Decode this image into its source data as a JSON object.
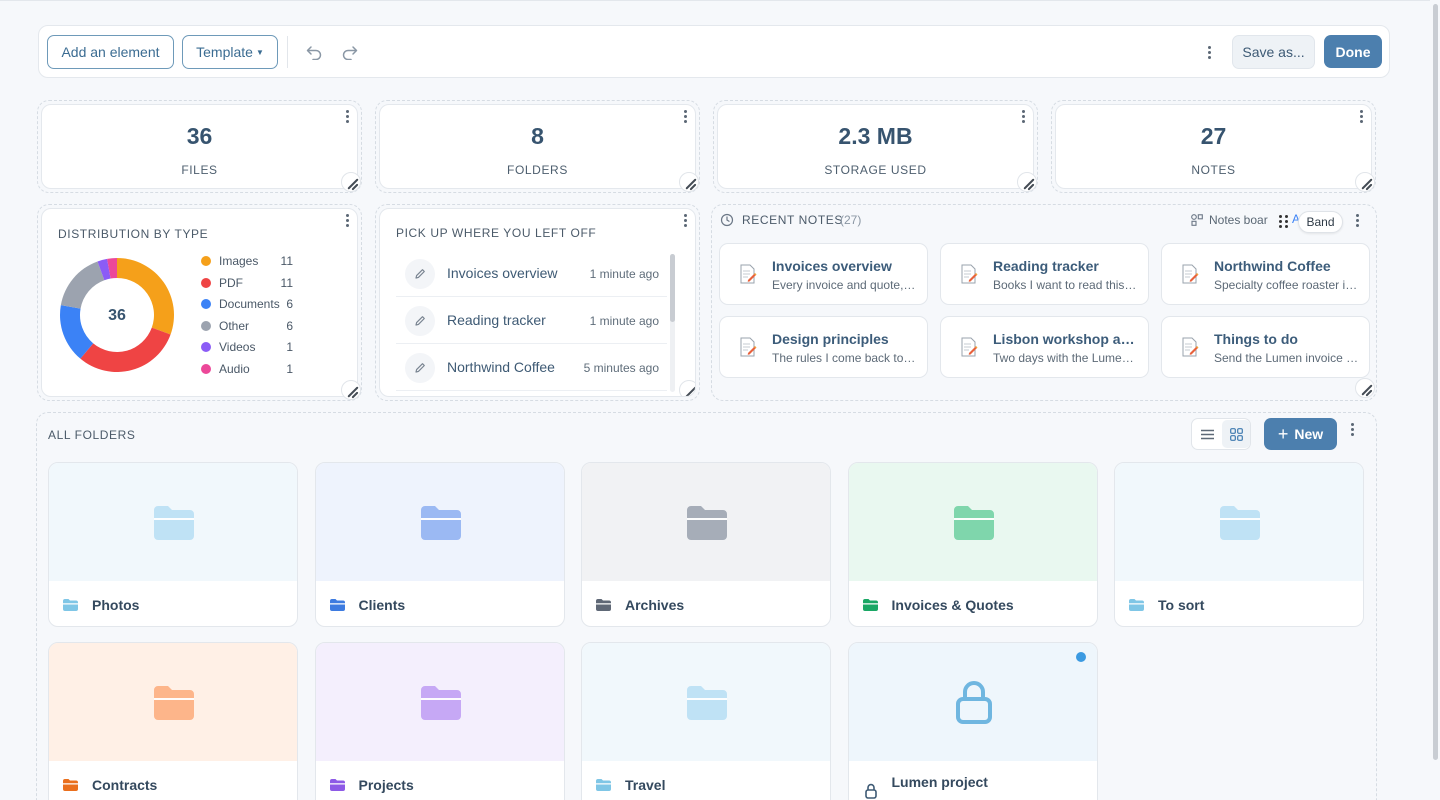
{
  "toolbar": {
    "add_element": "Add an element",
    "template": "Template",
    "save_as": "Save as...",
    "done": "Done"
  },
  "stats": [
    {
      "value": "36",
      "label": "FILES"
    },
    {
      "value": "8",
      "label": "FOLDERS"
    },
    {
      "value": "2.3 MB",
      "label": "STORAGE USED"
    },
    {
      "value": "27",
      "label": "NOTES"
    }
  ],
  "distribution": {
    "title": "DISTRIBUTION BY TYPE",
    "total": "36",
    "items": [
      {
        "name": "Images",
        "count": 11,
        "color": "#f5a01a"
      },
      {
        "name": "PDF",
        "count": 11,
        "color": "#ef4444"
      },
      {
        "name": "Documents",
        "count": 6,
        "color": "#3b82f6"
      },
      {
        "name": "Other",
        "count": 6,
        "color": "#9ca3af"
      },
      {
        "name": "Videos",
        "count": 1,
        "color": "#8b5cf6"
      },
      {
        "name": "Audio",
        "count": 1,
        "color": "#ec4899"
      }
    ]
  },
  "pickup": {
    "title": "PICK UP WHERE YOU LEFT OFF",
    "items": [
      {
        "title": "Invoices overview",
        "time": "1 minute ago"
      },
      {
        "title": "Reading tracker",
        "time": "1 minute ago"
      },
      {
        "title": "Northwind Coffee",
        "time": "5 minutes ago"
      }
    ]
  },
  "recent_notes": {
    "title": "RECENT NOTES",
    "count": "(27)",
    "board_label": "Notes boar",
    "board_extra": "A",
    "tooltip": "Band",
    "items": [
      {
        "title": "Invoices overview",
        "snippet": "Every invoice and quote, in one place"
      },
      {
        "title": "Reading tracker",
        "snippet": "Books I want to read this year"
      },
      {
        "title": "Northwind Coffee",
        "snippet": "Specialty coffee roaster in town"
      },
      {
        "title": "Design principles",
        "snippet": "The rules I come back to often"
      },
      {
        "title": "Lisbon workshop agenda",
        "snippet": "Two days with the Lumen team"
      },
      {
        "title": "Things to do",
        "snippet": "Send the Lumen invoice today"
      }
    ]
  },
  "folders": {
    "title": "ALL FOLDERS",
    "new_label": "New",
    "items": [
      {
        "name": "Photos",
        "color": "#bfe2f5",
        "bg": "#f1f8fc",
        "small": "#7fc6e6"
      },
      {
        "name": "Clients",
        "color": "#9bb9f3",
        "bg": "#eef3fd",
        "small": "#3d7be0"
      },
      {
        "name": "Archives",
        "color": "#a6adb8",
        "bg": "#f1f2f4",
        "small": "#5f6876"
      },
      {
        "name": "Invoices & Quotes",
        "color": "#7fd6ac",
        "bg": "#e9f8f0",
        "small": "#1aa765"
      },
      {
        "name": "To sort",
        "color": "#bfe2f5",
        "bg": "#f1f8fc",
        "small": "#7fc6e6"
      },
      {
        "name": "Contracts",
        "color": "#fdb58a",
        "bg": "#fff0e6",
        "small": "#ea6f1d"
      },
      {
        "name": "Projects",
        "color": "#c6a8f5",
        "bg": "#f4effd",
        "small": "#8d5ae6"
      },
      {
        "name": "Travel",
        "color": "#bfe2f5",
        "bg": "#f1f8fc",
        "small": "#7fc6e6"
      },
      {
        "name": "Lumen project",
        "locked": true,
        "bg": "#eef6fc",
        "lock_color": "#6fb6e0",
        "dot_color": "#3b9ae1"
      }
    ]
  }
}
